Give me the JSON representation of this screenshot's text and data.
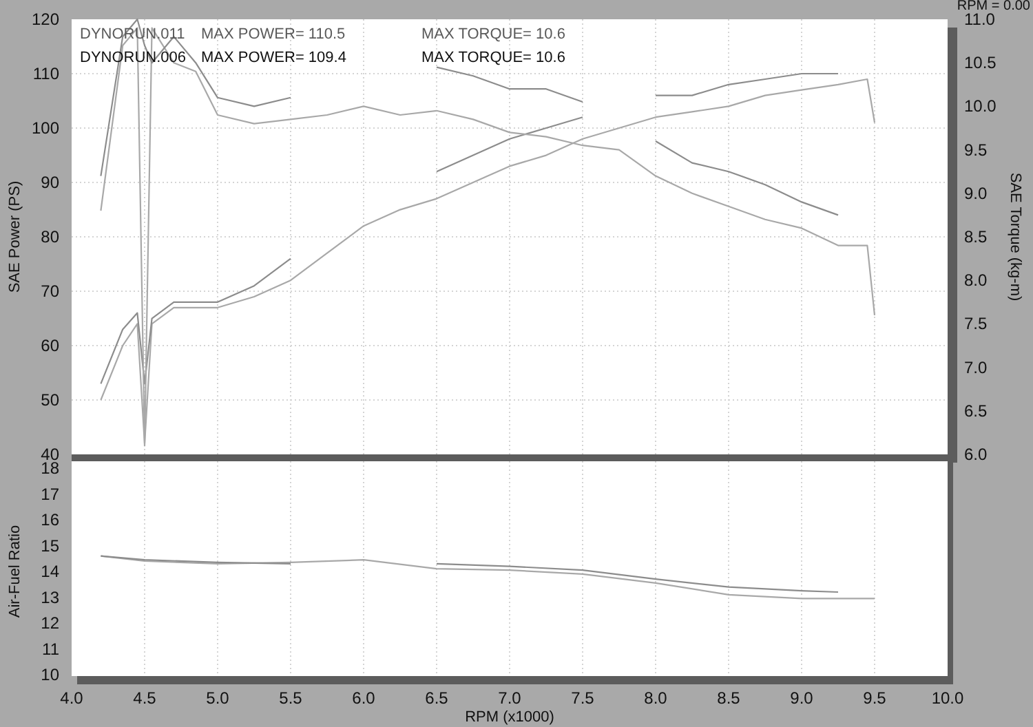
{
  "readout": "RPM = 0.00",
  "legend": [
    {
      "run": "DYNORUN.011",
      "power": "MAX POWER= 110.5",
      "torque": "MAX TORQUE= 10.6",
      "color": "#5a5a5a"
    },
    {
      "run": "DYNORUN.006",
      "power": "MAX POWER= 109.4",
      "torque": "MAX TORQUE= 10.6",
      "color": "#111111"
    }
  ],
  "power_chart": {
    "chart_data": {
      "type": "line",
      "ylabel": "SAE Power (PS)",
      "x": [
        4.2,
        4.35,
        4.45,
        4.5,
        4.55,
        4.7,
        4.85,
        5.0,
        5.25,
        5.5,
        5.75,
        6.0,
        6.25,
        6.5,
        6.75,
        7.0,
        7.25,
        7.5,
        7.75,
        8.0,
        8.25,
        8.5,
        8.75,
        9.0,
        9.25,
        9.45,
        9.5
      ],
      "xlim": [
        4,
        10
      ],
      "ylim": [
        40,
        120
      ],
      "yticks": [
        40,
        50,
        60,
        70,
        80,
        90,
        100,
        110,
        120
      ],
      "series": [
        {
          "color": "#a8a8a8",
          "values": [
            50,
            60,
            64,
            42,
            64,
            67,
            67,
            67,
            69,
            72,
            77,
            82,
            85,
            87,
            90,
            93,
            95,
            98,
            100,
            102,
            103,
            104,
            106,
            107,
            108,
            109,
            101
          ]
        },
        {
          "color": "#8c8c8c",
          "values": [
            53,
            63,
            66,
            53,
            65,
            68,
            68,
            68,
            71,
            76,
            null,
            null,
            null,
            92,
            95,
            98,
            100,
            102,
            null,
            106,
            106,
            108,
            109,
            110,
            110,
            null,
            null
          ]
        }
      ]
    }
  },
  "torque_chart": {
    "chart_data": {
      "type": "line",
      "ylabel": "SAE Torque (kg-m)",
      "x": [
        4.2,
        4.35,
        4.45,
        4.5,
        4.55,
        4.7,
        4.85,
        5.0,
        5.25,
        5.5,
        5.75,
        6.0,
        6.25,
        6.5,
        6.75,
        7.0,
        7.25,
        7.5,
        7.75,
        8.0,
        8.25,
        8.5,
        8.75,
        9.0,
        9.25,
        9.45,
        9.5
      ],
      "xlim": [
        4,
        10
      ],
      "ylim": [
        6,
        11
      ],
      "yticks": [
        {
          "value": 6,
          "label": "6.0"
        },
        {
          "value": 6.5,
          "label": "6.5"
        },
        {
          "value": 7,
          "label": "7.0"
        },
        {
          "value": 7.5,
          "label": "7.5"
        },
        {
          "value": 8,
          "label": "8.0"
        },
        {
          "value": 8.5,
          "label": "8.5"
        },
        {
          "value": 9,
          "label": "9.0"
        },
        {
          "value": 9.5,
          "label": "9.5"
        },
        {
          "value": 10,
          "label": "10.0"
        },
        {
          "value": 10.5,
          "label": "10.5"
        },
        {
          "value": 11,
          "label": "11.0"
        }
      ],
      "series": [
        {
          "color": "#a8a8a8",
          "values": [
            8.8,
            10.7,
            10.9,
            6.1,
            10.9,
            10.5,
            10.4,
            9.9,
            9.8,
            9.85,
            9.9,
            10.0,
            9.9,
            9.95,
            9.85,
            9.7,
            9.65,
            9.55,
            9.5,
            9.2,
            9.0,
            8.85,
            8.7,
            8.6,
            8.4,
            8.4,
            7.6
          ]
        },
        {
          "color": "#8c8c8c",
          "values": [
            9.2,
            10.8,
            11.0,
            10.7,
            10.5,
            10.8,
            10.5,
            10.1,
            10.0,
            10.1,
            null,
            null,
            null,
            10.45,
            10.35,
            10.2,
            10.2,
            10.05,
            null,
            9.6,
            9.35,
            9.25,
            9.1,
            8.9,
            8.75,
            null,
            null
          ]
        }
      ]
    }
  },
  "afr_chart": {
    "chart_data": {
      "type": "line",
      "xlabel": "RPM (x1000)",
      "ylabel": "Air-Fuel Ratio",
      "x": [
        4.2,
        4.5,
        5.0,
        5.5,
        6.0,
        6.5,
        7.0,
        7.5,
        8.0,
        8.5,
        9.0,
        9.25,
        9.5
      ],
      "xlim": [
        4,
        10
      ],
      "ylim": [
        10,
        18
      ],
      "xticks": [
        {
          "value": 4,
          "label": "4.0"
        },
        {
          "value": 4.5,
          "label": "4.5"
        },
        {
          "value": 5,
          "label": "5.0"
        },
        {
          "value": 5.5,
          "label": "5.5"
        },
        {
          "value": 6,
          "label": "6.0"
        },
        {
          "value": 6.5,
          "label": "6.5"
        },
        {
          "value": 7,
          "label": "7.0"
        },
        {
          "value": 7.5,
          "label": "7.5"
        },
        {
          "value": 8,
          "label": "8.0"
        },
        {
          "value": 8.5,
          "label": "8.5"
        },
        {
          "value": 9,
          "label": "9.0"
        },
        {
          "value": 9.5,
          "label": "9.5"
        },
        {
          "value": 10,
          "label": "10.0"
        }
      ],
      "yticks": [
        10,
        11,
        12,
        13,
        14,
        15,
        16,
        17,
        18
      ],
      "series": [
        {
          "color": "#a8a8a8",
          "values": [
            14.6,
            14.4,
            14.3,
            14.35,
            14.45,
            14.1,
            14.05,
            13.9,
            13.55,
            13.1,
            12.95,
            12.95,
            12.95
          ]
        },
        {
          "color": "#8c8c8c",
          "values": [
            14.6,
            14.45,
            14.35,
            14.3,
            null,
            14.3,
            14.2,
            14.05,
            13.7,
            13.4,
            13.25,
            13.2,
            null
          ]
        }
      ]
    }
  }
}
